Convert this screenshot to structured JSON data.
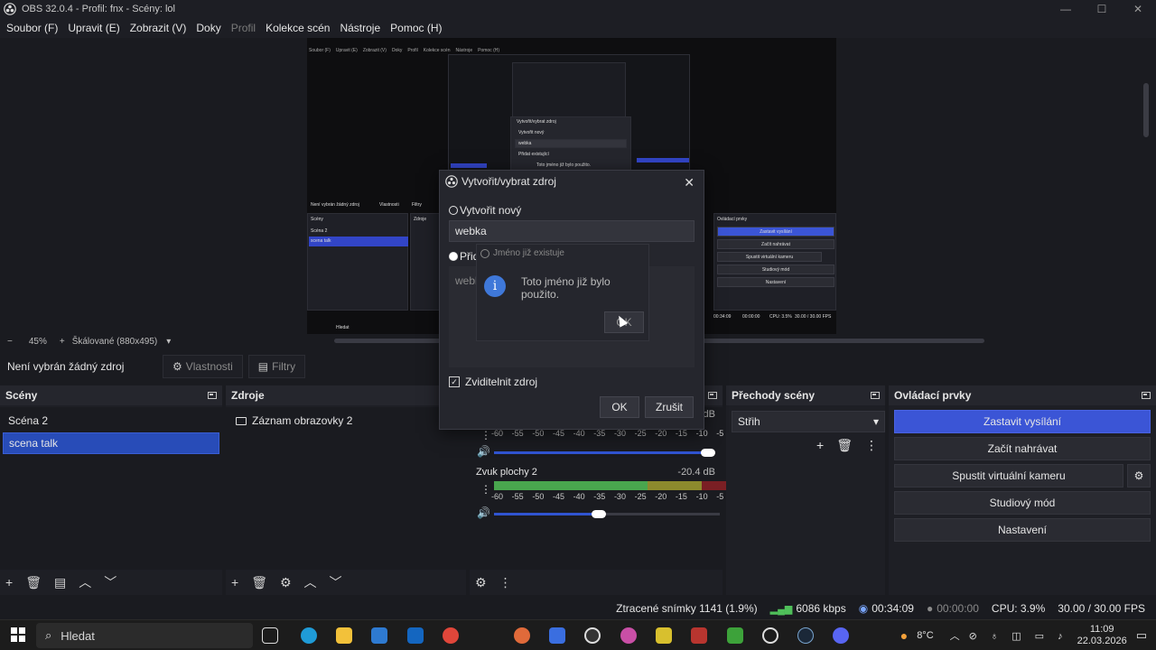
{
  "window": {
    "title": "OBS 32.0.4 - Profil: fnx - Scény: lol",
    "controls": {
      "minimize": "—",
      "maximize": "☐",
      "close": "✕"
    }
  },
  "menu": [
    "Soubor (F)",
    "Upravit (E)",
    "Zobrazit (V)",
    "Doky",
    "Profil",
    "Kolekce scén",
    "Nástroje",
    "Pomoc (H)"
  ],
  "preview": {
    "mini_menu": [
      "Soubor (F)",
      "Upravit (E)",
      "Zobrazit (V)",
      "Doky",
      "Profil",
      "Kolekce scén",
      "Nástroje",
      "Pomoc (H)"
    ],
    "mini_no_source": "Není vybrán žádný zdroj",
    "mini_properties": "Vlastnosti",
    "mini_filters": "Filtry",
    "mini_scenes_header": "Scény",
    "mini_sources_header": "Zdroje",
    "mini_scenes": [
      "Scéna 2",
      "scena talk"
    ],
    "mini_controls_header": "Ovládací prvky",
    "mini_controls": [
      "Zastavit vysílání",
      "Začít nahrávat",
      "Spustit virtuální kameru",
      "Studiový mód",
      "Nastavení"
    ],
    "mini_search": "Hledat",
    "mini_status": [
      "00:34:09",
      "00:00:00",
      "CPU: 3.5%",
      "30.00 / 30.00 FPS"
    ],
    "mini_dialog_title": "Vytvořit/vybrat zdroj",
    "mini_dialog_create": "Vytvořit nový",
    "mini_dialog_value": "webka",
    "mini_dialog_add": "Přidat existující",
    "mini_msg": "Toto jméno již bylo použito."
  },
  "zoom": {
    "percent": "45%",
    "minus": "−",
    "plus": "+",
    "scale_mode": "Škálované (880x495)"
  },
  "source_toolbar": {
    "no_source": "Není vybrán žádný zdroj",
    "properties": "Vlastnosti",
    "filters": "Filtry"
  },
  "scenes": {
    "header": "Scény",
    "items": [
      "Scéna 2",
      "scena talk"
    ],
    "selected_index": 1
  },
  "sources": {
    "header": "Zdroje",
    "items": [
      {
        "label": "Záznam obrazovky 2"
      }
    ]
  },
  "mixer": {
    "channels": [
      {
        "name": "",
        "db": "dB",
        "level": 0.0,
        "volume": 1.0
      },
      {
        "name": "Zvuk plochy 2",
        "db": "-20.4 dB",
        "level": 0.88,
        "volume": 0.45
      }
    ],
    "scale": [
      "-60",
      "-55",
      "-50",
      "-45",
      "-40",
      "-35",
      "-30",
      "-25",
      "-20",
      "-15",
      "-10",
      "-5",
      "0"
    ]
  },
  "transitions": {
    "header": "Přechody scény",
    "selected": "Střih"
  },
  "controls": {
    "header": "Ovládací prvky",
    "stop_stream": "Zastavit vysílání",
    "start_record": "Začít nahrávat",
    "virtual_cam": "Spustit virtuální kameru",
    "studio_mode": "Studiový mód",
    "settings": "Nastavení"
  },
  "status": {
    "dropped": "Ztracené snímky 1141 (1.9%)",
    "bitrate": "6086 kbps",
    "stream_time": "00:34:09",
    "rec_time": "00:00:00",
    "cpu": "CPU: 3.9%",
    "fps": "30.00 / 30.00 FPS"
  },
  "dialog": {
    "title": "Vytvořit/vybrat zdroj",
    "create_new": "Vytvořit nový",
    "name_value": "webka",
    "add_existing": "Přidat existující",
    "list_item": "webka",
    "visible_label": "Zviditelnit zdroj",
    "ok": "OK",
    "cancel": "Zrušit"
  },
  "message_box": {
    "title": "Jméno již existuje",
    "text": "Toto jméno již bylo použito.",
    "ok": "OK"
  },
  "taskbar": {
    "search": "Hledat",
    "weather": "8°C",
    "time": "11:09",
    "date": "22.03.2026"
  },
  "colors": {
    "accent": "#3b55d6",
    "selected_scene": "#284cb8",
    "meter_green": "#49a64e",
    "meter_yellow": "#8c8a2d",
    "meter_red": "#7a1f24",
    "bg": "#1a1b20"
  }
}
